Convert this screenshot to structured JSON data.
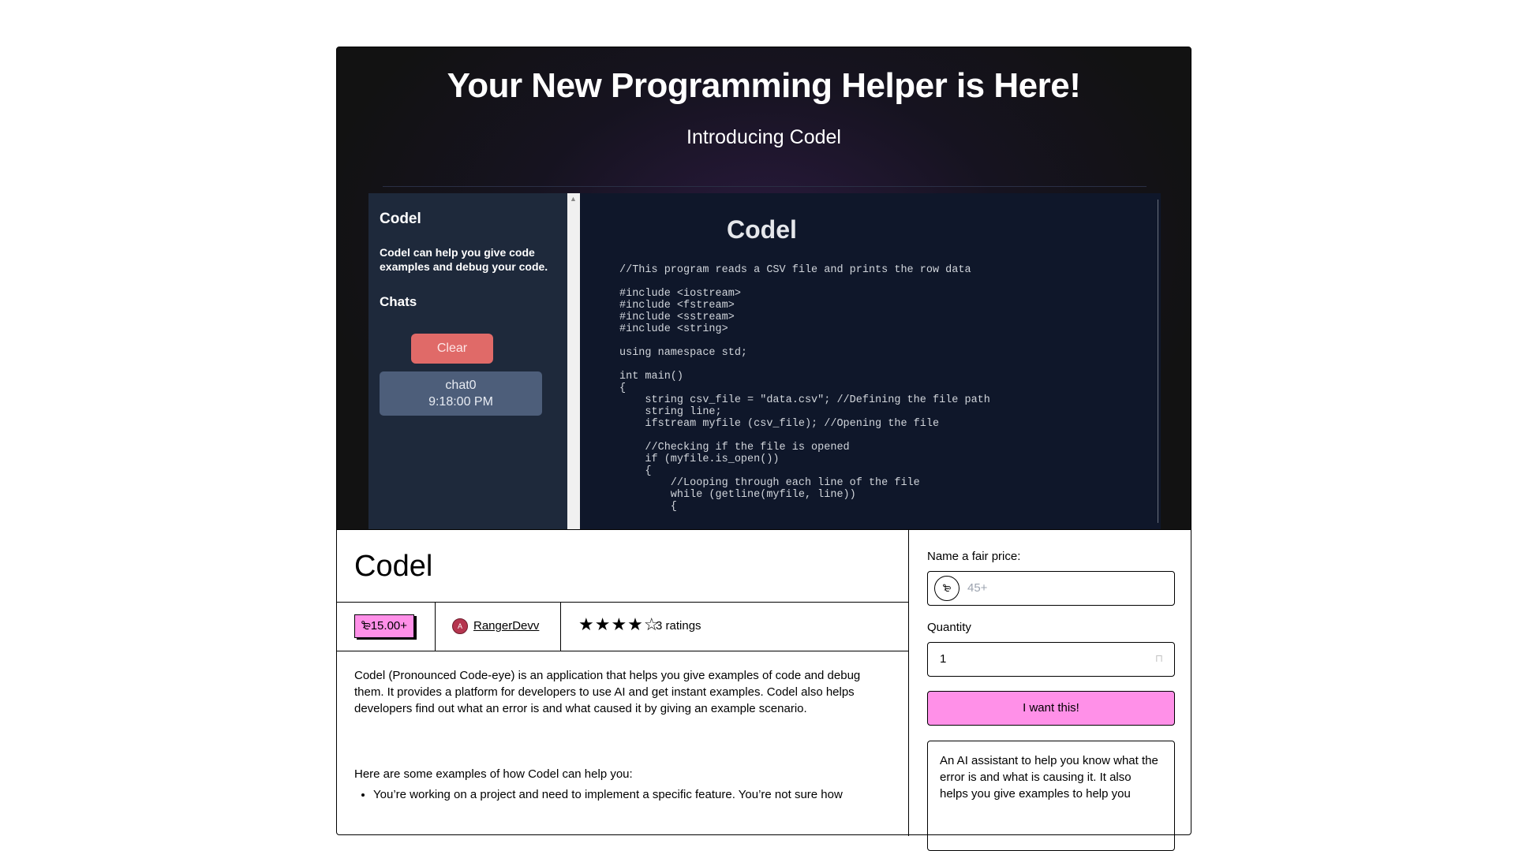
{
  "hero": {
    "title": "Your New Programming Helper is Here!",
    "subtitle": "Introducing Codel",
    "screenshot": {
      "sidebar_title": "Codel",
      "sidebar_desc": "Codel can help you give code examples and debug your code.",
      "chats_label": "Chats",
      "clear_label": "Clear",
      "chat_name": "chat0",
      "chat_time": "9:18:00 PM",
      "main_title": "Codel",
      "code": "//This program reads a CSV file and prints the row data\n\n#include <iostream>\n#include <fstream>\n#include <sstream>\n#include <string>\n\nusing namespace std;\n\nint main()\n{\n    string csv_file = \"data.csv\"; //Defining the file path\n    string line;\n    ifstream myfile (csv_file); //Opening the file\n\n    //Checking if the file is opened\n    if (myfile.is_open())\n    {\n        //Looping through each line of the file\n        while (getline(myfile, line))\n        {"
    }
  },
  "product": {
    "title": "Codel",
    "price": "₻15.00+",
    "creator_initial": "A",
    "creator": "RangerDevv",
    "stars": "★★★★☆",
    "rating": 4,
    "ratings_text": "3 ratings",
    "description": "Codel (Pronounced Code-eye) is an application that helps you give examples of code and debug them. It provides a platform for developers to use AI and get instant examples. Codel also helps developers find out what an error is and what caused it by giving an example scenario.",
    "examples_heading": "Here are some examples of how Codel can help you:",
    "bullets": [
      "You’re working on a project and need to implement a specific feature. You’re not sure how"
    ]
  },
  "purchase": {
    "price_label": "Name a fair price:",
    "currency_symbol": "₻",
    "price_placeholder": "45+",
    "quantity_label": "Quantity",
    "quantity_value": "1",
    "buy_label": "I want this!",
    "summary": "An AI assistant to help you know what the error is and what is causing it. It also helps you give examples to help you"
  },
  "colors": {
    "accent": "#ff90e8",
    "hero_bg": "#121212",
    "clear_button": "#e06a68",
    "avatar": "#b5354f"
  },
  "icons": {
    "currency": "currency-circle-icon",
    "stepper": "stepper-icon",
    "stars": "star-icon",
    "scroll": "scroll-up-arrow-icon"
  }
}
